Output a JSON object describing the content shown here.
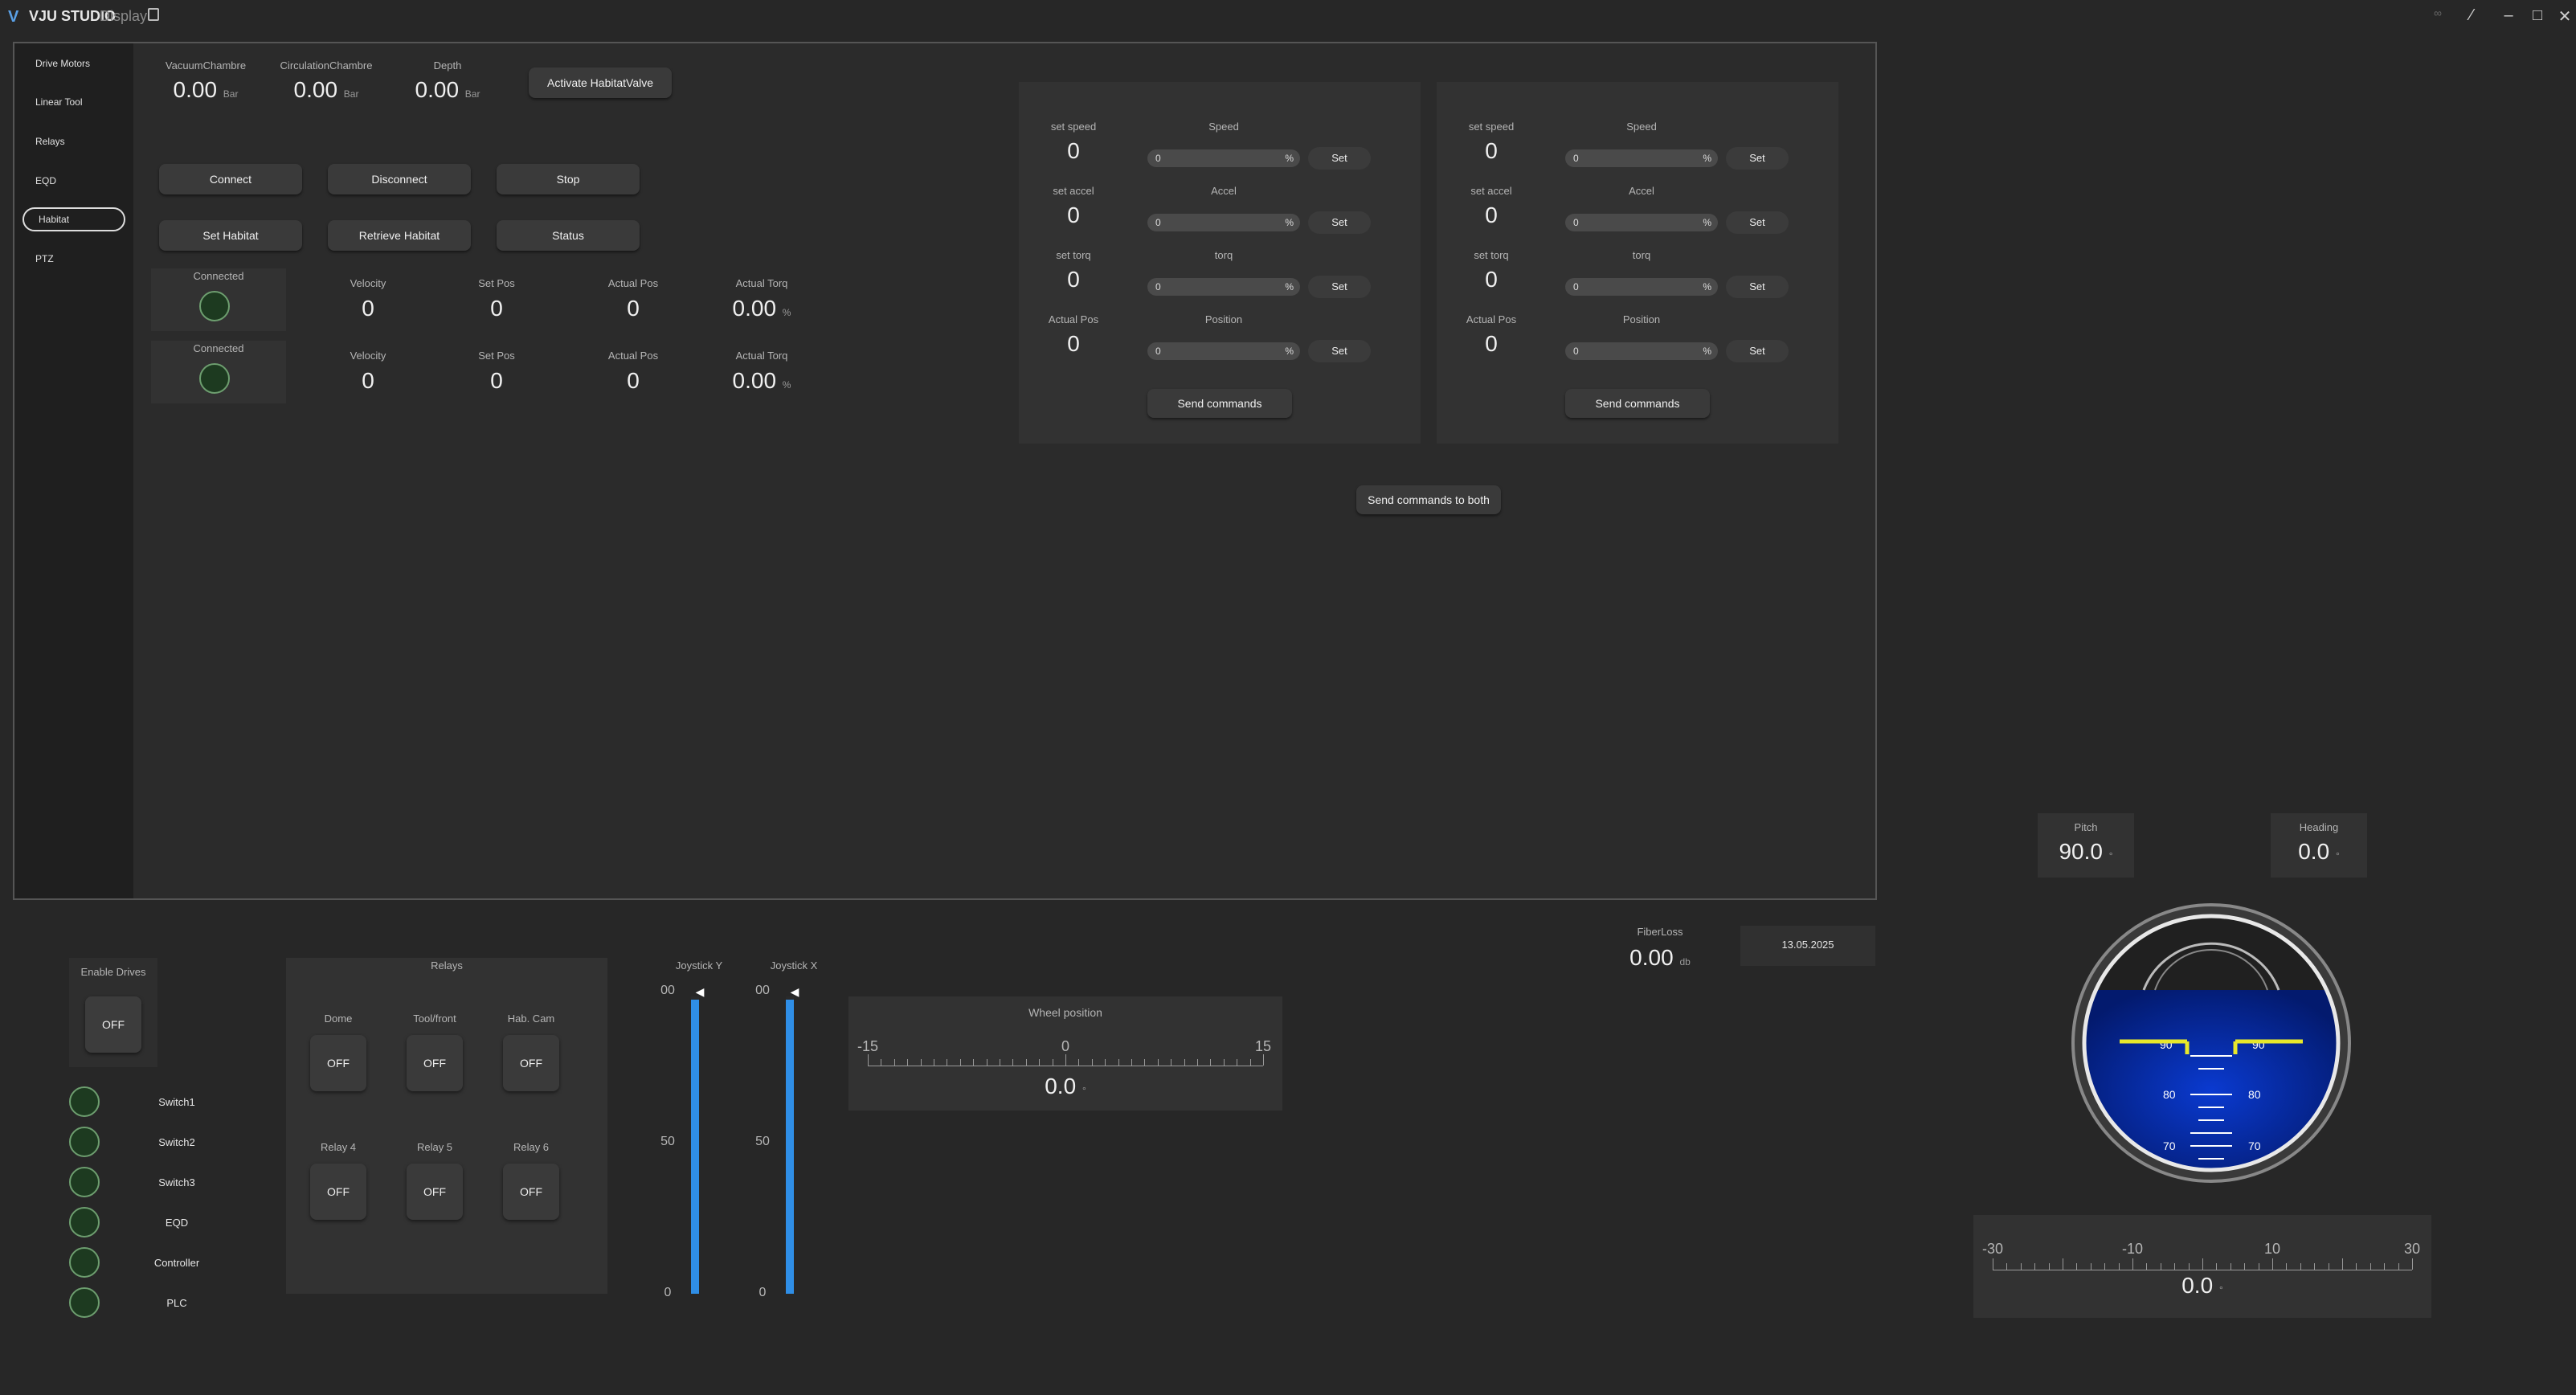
{
  "titlebar": {
    "brand": "VJU STUDIO",
    "subtitle": "Display"
  },
  "sidebar": {
    "items": [
      {
        "label": "Drive Motors"
      },
      {
        "label": "Linear Tool"
      },
      {
        "label": "Relays"
      },
      {
        "label": "EQD"
      },
      {
        "label": "Habitat"
      },
      {
        "label": "PTZ"
      }
    ],
    "active": "Habitat"
  },
  "habitat": {
    "pressures": [
      {
        "label": "VacuumChambre",
        "value": "0.00",
        "unit": "Bar"
      },
      {
        "label": "CirculationChambre",
        "value": "0.00",
        "unit": "Bar"
      },
      {
        "label": "Depth",
        "value": "0.00",
        "unit": "Bar"
      }
    ],
    "activate_valve": "Activate HabitatValve",
    "buttons_row1": [
      "Connect",
      "Disconnect",
      "Stop"
    ],
    "buttons_row2": [
      "Set Habitat",
      "Retrieve Habitat",
      "Status"
    ],
    "rows": [
      {
        "status": "Connected",
        "velocity_label": "Velocity",
        "velocity": "0",
        "setpos_label": "Set Pos",
        "setpos": "0",
        "actpos_label": "Actual Pos",
        "actpos": "0",
        "torq_label": "Actual Torq",
        "torq": "0.00",
        "torq_unit": "%"
      },
      {
        "status": "Connected",
        "velocity_label": "Velocity",
        "velocity": "0",
        "setpos_label": "Set Pos",
        "setpos": "0",
        "actpos_label": "Actual Pos",
        "actpos": "0",
        "torq_label": "Actual Torq",
        "torq": "0.00",
        "torq_unit": "%"
      }
    ]
  },
  "motor_panels": [
    {
      "params": [
        {
          "left_label": "set speed",
          "left_value": "0",
          "slider_label": "Speed",
          "slider_value": "0",
          "unit": "%",
          "set": "Set"
        },
        {
          "left_label": "set accel",
          "left_value": "0",
          "slider_label": "Accel",
          "slider_value": "0",
          "unit": "%",
          "set": "Set"
        },
        {
          "left_label": "set torq",
          "left_value": "0",
          "slider_label": "torq",
          "slider_value": "0",
          "unit": "%",
          "set": "Set"
        },
        {
          "left_label": "Actual Pos",
          "left_value": "0",
          "slider_label": "Position",
          "slider_value": "0",
          "unit": "%",
          "set": "Set"
        }
      ],
      "send": "Send commands"
    },
    {
      "params": [
        {
          "left_label": "set speed",
          "left_value": "0",
          "slider_label": "Speed",
          "slider_value": "0",
          "unit": "%",
          "set": "Set"
        },
        {
          "left_label": "set accel",
          "left_value": "0",
          "slider_label": "Accel",
          "slider_value": "0",
          "unit": "%",
          "set": "Set"
        },
        {
          "left_label": "set torq",
          "left_value": "0",
          "slider_label": "torq",
          "slider_value": "0",
          "unit": "%",
          "set": "Set"
        },
        {
          "left_label": "Actual Pos",
          "left_value": "0",
          "slider_label": "Position",
          "slider_value": "0",
          "unit": "%",
          "set": "Set"
        }
      ],
      "send": "Send commands"
    }
  ],
  "send_both": "Send commands to both",
  "bottom": {
    "enable_drives": {
      "label": "Enable Drives",
      "state": "OFF"
    },
    "switches": [
      "Switch1",
      "Switch2",
      "Switch3",
      "EQD",
      "Controller",
      "PLC"
    ],
    "relays": {
      "title": "Relays",
      "items": [
        {
          "label": "Dome",
          "state": "OFF"
        },
        {
          "label": "Tool/front",
          "state": "OFF"
        },
        {
          "label": "Hab. Cam",
          "state": "OFF"
        },
        {
          "label": "Relay 4",
          "state": "OFF"
        },
        {
          "label": "Relay 5",
          "state": "OFF"
        },
        {
          "label": "Relay 6",
          "state": "OFF"
        }
      ]
    },
    "joysticks": [
      {
        "label": "Joystick Y",
        "top": "00",
        "mid": "50",
        "bottom": "0",
        "level": 0.99
      },
      {
        "label": "Joystick X",
        "top": "00",
        "mid": "50",
        "bottom": "0",
        "level": 0.99
      }
    ],
    "wheel": {
      "title": "Wheel position",
      "ticks": [
        "-15",
        "0",
        "15"
      ],
      "value": "0.0",
      "unit": "°"
    },
    "fiber": {
      "label": "FiberLoss",
      "value": "0.00",
      "unit": "db"
    },
    "date": "13.05.2025",
    "pitch": {
      "label": "Pitch",
      "value": "90.0",
      "unit": "°"
    },
    "heading": {
      "label": "Heading",
      "value": "0.0",
      "unit": "°"
    },
    "horizon_marks": [
      "90",
      "90",
      "80",
      "80",
      "70",
      "70"
    ],
    "roll": {
      "ticks": [
        "-30",
        "-10",
        "10",
        "30"
      ],
      "value": "0.0",
      "unit": "°"
    }
  },
  "colors": {
    "accent": "#2f8ee6",
    "led_off": "#1d3a20",
    "horizon_blue": "#0a2fa8",
    "horizon_yellow": "#e8e82a"
  }
}
